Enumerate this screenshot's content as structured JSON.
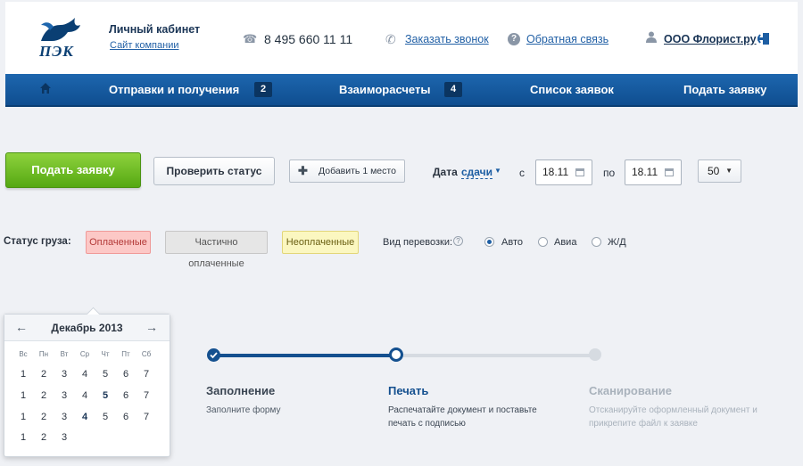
{
  "colors": {
    "primary": "#1d5ea3",
    "accent_green": "#55a812",
    "nav_bg": "#1d66ae",
    "page_bg": "#eff1f5"
  },
  "header": {
    "logo_text": "ПЭК",
    "cabinet_title": "Личный кабинет",
    "company_site_link": "Сайт компании",
    "phone_icon": "phone-icon",
    "phone": "8 495 660 11 11",
    "callback_link": "Заказать звонок",
    "feedback_icon_glyph": "?",
    "feedback_link": "Обратная связь",
    "user_name": "ООО Флорист.ру"
  },
  "nav": {
    "items": [
      {
        "label": "Отправки и получения",
        "badge": "2"
      },
      {
        "label": "Взаиморасчеты",
        "badge": "4"
      },
      {
        "label": "Список заявок"
      },
      {
        "label": "Подать заявку"
      }
    ]
  },
  "toolbar": {
    "submit_request": "Подать заявку",
    "check_status": "Проверить статус",
    "add_place": "Добавить 1 место",
    "date_label": "Дата",
    "date_mode": "сдачи",
    "from_label": "с",
    "from_value": "18.11",
    "to_label": "по",
    "to_value": "18.11",
    "per_page": "50"
  },
  "filters": {
    "status_label": "Статус груза:",
    "chips": [
      "Оплаченные",
      "Частично оплаченные",
      "Неоплаченные"
    ],
    "transport_label": "Вид перевозки:",
    "help_glyph": "?",
    "transport_options": [
      {
        "label": "Авто",
        "checked": true
      },
      {
        "label": "Авиа",
        "checked": false
      },
      {
        "label": "Ж/Д",
        "checked": false
      }
    ]
  },
  "calendar": {
    "prev_glyph": "←",
    "next_glyph": "→",
    "month": "Декабрь 2013",
    "weekdays": [
      "Вс",
      "Пн",
      "Вт",
      "Ср",
      "Чт",
      "Пт",
      "Сб"
    ],
    "rows": [
      [
        "1",
        "2",
        "3",
        "4",
        "5",
        "6",
        "7"
      ],
      [
        "1",
        "2",
        "3",
        "4",
        "5",
        "6",
        "7"
      ],
      [
        "1",
        "2",
        "3",
        "4",
        "5",
        "6",
        "7"
      ],
      [
        "1",
        "2",
        "3"
      ]
    ]
  },
  "steps": [
    {
      "title": "Заполнение",
      "desc": "Заполните форму",
      "state": "done"
    },
    {
      "title": "Печать",
      "desc": "Распечатайте документ и поставьте печать с подписью",
      "state": "current"
    },
    {
      "title": "Сканирование",
      "desc": "Отсканируйте оформленный документ и прикрепите файл к заявке",
      "state": "todo"
    }
  ]
}
